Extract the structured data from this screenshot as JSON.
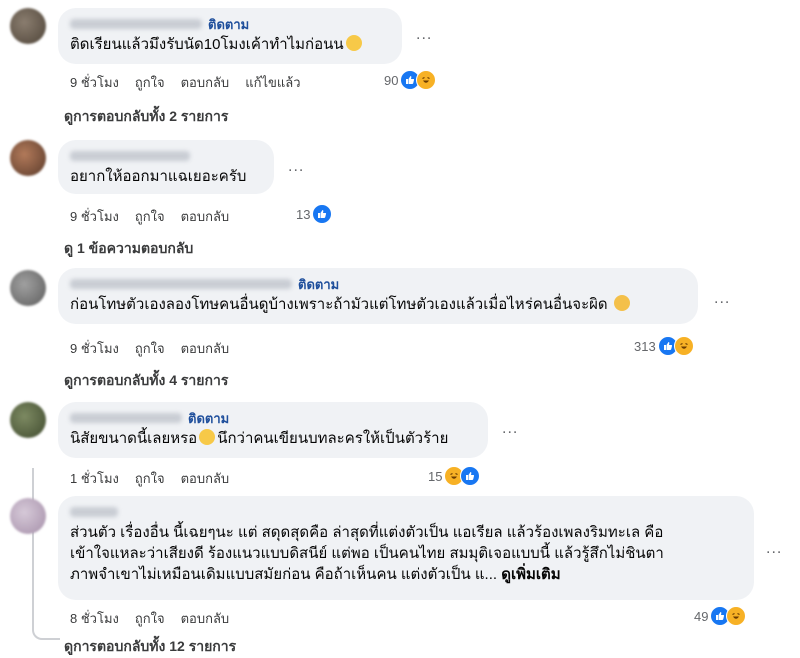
{
  "comments": [
    {
      "follow_label": "ติดตาม",
      "text": "ติดเรียนแล้วมึงรับนัด10โมงเค้าทำไมก่อนน",
      "time": "9 ชั่วโมง",
      "like_label": "ถูกใจ",
      "reply_label": "ตอบกลับ",
      "edited_label": "แก้ไขแล้ว",
      "reaction_count": "90",
      "replies_label": "ดูการตอบกลับทั้ง 2 รายการ"
    },
    {
      "text": "อยากให้ออกมาแฉเยอะครับ",
      "time": "9 ชั่วโมง",
      "like_label": "ถูกใจ",
      "reply_label": "ตอบกลับ",
      "reaction_count": "13",
      "replies_label": "ดู 1 ข้อความตอบกลับ"
    },
    {
      "follow_label": "ติดตาม",
      "text": "ก่อนโทษตัวเองลองโทษคนอื่นดูบ้างเพราะถ้ามัวแต่โทษตัวเองแล้วเมื่อไหร่คนอื่นจะผิด",
      "time": "9 ชั่วโมง",
      "like_label": "ถูกใจ",
      "reply_label": "ตอบกลับ",
      "reaction_count": "313",
      "replies_label": "ดูการตอบกลับทั้ง 4 รายการ"
    },
    {
      "follow_label": "ติดตาม",
      "text_before": "นิสัยขนาดนี้เลยหรอ",
      "text_after": "นึกว่าคนเขียนบทละครให้เป็นตัวร้าย",
      "time": "1 ชั่วโมง",
      "like_label": "ถูกใจ",
      "reply_label": "ตอบกลับ",
      "reaction_count": "15"
    },
    {
      "text_line1": "ส่วนตัว เรื่องอื่น นี้เฉยๆนะ แต่ สดุดสุดคือ ล่าสุดที่แต่งตัวเป็น แอเรียล แล้วร้องเพลงริมทะเล คือ",
      "text_line2": "เข้าใจแหละว่าเสียงดี ร้องแนวแบบดิสนีย์ แต่พอ เป็นคนไทย สมมุติเจอแบบนี้ แล้วรู้สึกไม่ชินตา",
      "text_line3": "ภาพจำเขาไม่เหมือนเดิมแบบสมัยก่อน คือถ้าเห็นคน แต่งตัวเป็น แ...",
      "see_more": "ดูเพิ่มเติม",
      "time": "8 ชั่วโมง",
      "like_label": "ถูกใจ",
      "reply_label": "ตอบกลับ",
      "reaction_count": "49",
      "replies_label": "ดูการตอบกลับทั้ง 12 รายการ"
    }
  ],
  "more_options": "...",
  "icons": {
    "like": "like-reaction-icon",
    "haha": "haha-reaction-icon"
  },
  "colors": {
    "bubble": "#f0f2f5",
    "follow": "#1f4f9c",
    "like": "#1877f2",
    "haha": "#f7b125"
  }
}
